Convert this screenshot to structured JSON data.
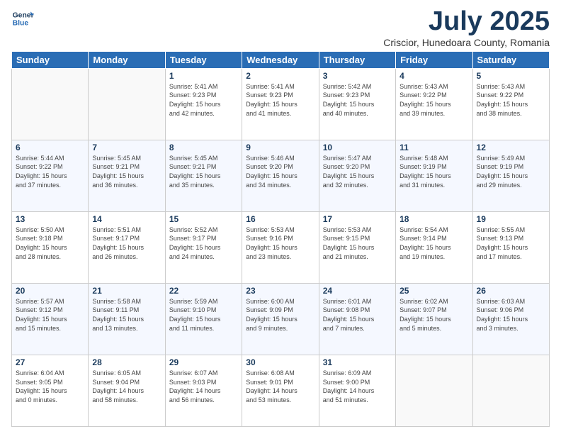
{
  "logo": {
    "line1": "General",
    "line2": "Blue"
  },
  "title": "July 2025",
  "subtitle": "Criscior, Hunedoara County, Romania",
  "headers": [
    "Sunday",
    "Monday",
    "Tuesday",
    "Wednesday",
    "Thursday",
    "Friday",
    "Saturday"
  ],
  "weeks": [
    [
      {
        "day": "",
        "info": ""
      },
      {
        "day": "",
        "info": ""
      },
      {
        "day": "1",
        "info": "Sunrise: 5:41 AM\nSunset: 9:23 PM\nDaylight: 15 hours\nand 42 minutes."
      },
      {
        "day": "2",
        "info": "Sunrise: 5:41 AM\nSunset: 9:23 PM\nDaylight: 15 hours\nand 41 minutes."
      },
      {
        "day": "3",
        "info": "Sunrise: 5:42 AM\nSunset: 9:23 PM\nDaylight: 15 hours\nand 40 minutes."
      },
      {
        "day": "4",
        "info": "Sunrise: 5:43 AM\nSunset: 9:22 PM\nDaylight: 15 hours\nand 39 minutes."
      },
      {
        "day": "5",
        "info": "Sunrise: 5:43 AM\nSunset: 9:22 PM\nDaylight: 15 hours\nand 38 minutes."
      }
    ],
    [
      {
        "day": "6",
        "info": "Sunrise: 5:44 AM\nSunset: 9:22 PM\nDaylight: 15 hours\nand 37 minutes."
      },
      {
        "day": "7",
        "info": "Sunrise: 5:45 AM\nSunset: 9:21 PM\nDaylight: 15 hours\nand 36 minutes."
      },
      {
        "day": "8",
        "info": "Sunrise: 5:45 AM\nSunset: 9:21 PM\nDaylight: 15 hours\nand 35 minutes."
      },
      {
        "day": "9",
        "info": "Sunrise: 5:46 AM\nSunset: 9:20 PM\nDaylight: 15 hours\nand 34 minutes."
      },
      {
        "day": "10",
        "info": "Sunrise: 5:47 AM\nSunset: 9:20 PM\nDaylight: 15 hours\nand 32 minutes."
      },
      {
        "day": "11",
        "info": "Sunrise: 5:48 AM\nSunset: 9:19 PM\nDaylight: 15 hours\nand 31 minutes."
      },
      {
        "day": "12",
        "info": "Sunrise: 5:49 AM\nSunset: 9:19 PM\nDaylight: 15 hours\nand 29 minutes."
      }
    ],
    [
      {
        "day": "13",
        "info": "Sunrise: 5:50 AM\nSunset: 9:18 PM\nDaylight: 15 hours\nand 28 minutes."
      },
      {
        "day": "14",
        "info": "Sunrise: 5:51 AM\nSunset: 9:17 PM\nDaylight: 15 hours\nand 26 minutes."
      },
      {
        "day": "15",
        "info": "Sunrise: 5:52 AM\nSunset: 9:17 PM\nDaylight: 15 hours\nand 24 minutes."
      },
      {
        "day": "16",
        "info": "Sunrise: 5:53 AM\nSunset: 9:16 PM\nDaylight: 15 hours\nand 23 minutes."
      },
      {
        "day": "17",
        "info": "Sunrise: 5:53 AM\nSunset: 9:15 PM\nDaylight: 15 hours\nand 21 minutes."
      },
      {
        "day": "18",
        "info": "Sunrise: 5:54 AM\nSunset: 9:14 PM\nDaylight: 15 hours\nand 19 minutes."
      },
      {
        "day": "19",
        "info": "Sunrise: 5:55 AM\nSunset: 9:13 PM\nDaylight: 15 hours\nand 17 minutes."
      }
    ],
    [
      {
        "day": "20",
        "info": "Sunrise: 5:57 AM\nSunset: 9:12 PM\nDaylight: 15 hours\nand 15 minutes."
      },
      {
        "day": "21",
        "info": "Sunrise: 5:58 AM\nSunset: 9:11 PM\nDaylight: 15 hours\nand 13 minutes."
      },
      {
        "day": "22",
        "info": "Sunrise: 5:59 AM\nSunset: 9:10 PM\nDaylight: 15 hours\nand 11 minutes."
      },
      {
        "day": "23",
        "info": "Sunrise: 6:00 AM\nSunset: 9:09 PM\nDaylight: 15 hours\nand 9 minutes."
      },
      {
        "day": "24",
        "info": "Sunrise: 6:01 AM\nSunset: 9:08 PM\nDaylight: 15 hours\nand 7 minutes."
      },
      {
        "day": "25",
        "info": "Sunrise: 6:02 AM\nSunset: 9:07 PM\nDaylight: 15 hours\nand 5 minutes."
      },
      {
        "day": "26",
        "info": "Sunrise: 6:03 AM\nSunset: 9:06 PM\nDaylight: 15 hours\nand 3 minutes."
      }
    ],
    [
      {
        "day": "27",
        "info": "Sunrise: 6:04 AM\nSunset: 9:05 PM\nDaylight: 15 hours\nand 0 minutes."
      },
      {
        "day": "28",
        "info": "Sunrise: 6:05 AM\nSunset: 9:04 PM\nDaylight: 14 hours\nand 58 minutes."
      },
      {
        "day": "29",
        "info": "Sunrise: 6:07 AM\nSunset: 9:03 PM\nDaylight: 14 hours\nand 56 minutes."
      },
      {
        "day": "30",
        "info": "Sunrise: 6:08 AM\nSunset: 9:01 PM\nDaylight: 14 hours\nand 53 minutes."
      },
      {
        "day": "31",
        "info": "Sunrise: 6:09 AM\nSunset: 9:00 PM\nDaylight: 14 hours\nand 51 minutes."
      },
      {
        "day": "",
        "info": ""
      },
      {
        "day": "",
        "info": ""
      }
    ]
  ]
}
